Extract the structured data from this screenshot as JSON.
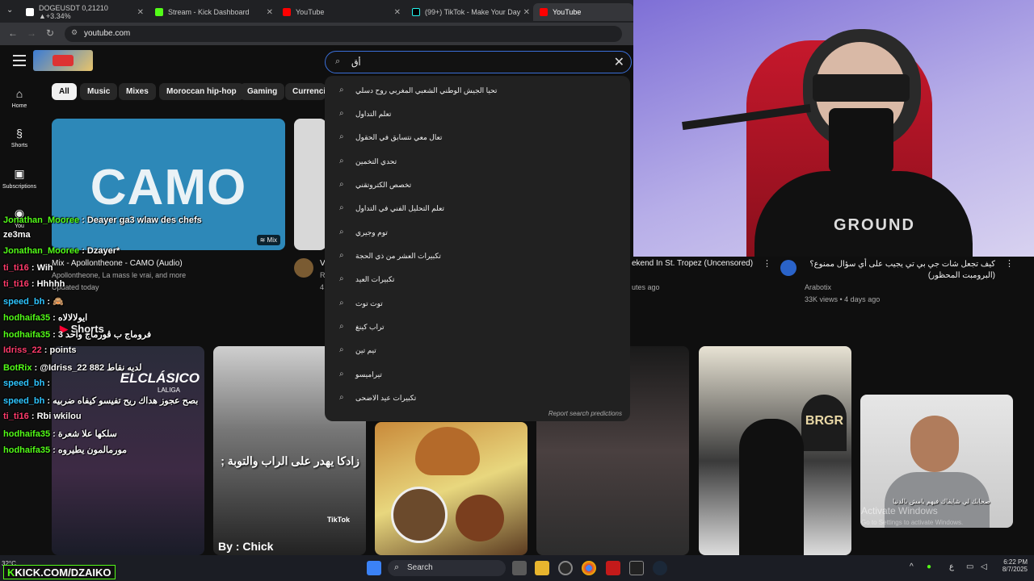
{
  "browser": {
    "tabs": [
      {
        "label": "DOGEUSDT 0,21210 ▲+3.34%",
        "active": false
      },
      {
        "label": "Stream - Kick Dashboard",
        "active": false
      },
      {
        "label": "YouTube",
        "active": false
      },
      {
        "label": "(99+) TikTok - Make Your Day",
        "active": false
      },
      {
        "label": "YouTube",
        "active": true
      }
    ],
    "url": "youtube.com"
  },
  "youtube": {
    "search_query": "أق",
    "sidebar": [
      {
        "label": "Home",
        "icon": "home-icon"
      },
      {
        "label": "Shorts",
        "icon": "shorts-icon"
      },
      {
        "label": "Subscriptions",
        "icon": "subscriptions-icon"
      },
      {
        "label": "You",
        "icon": "you-icon"
      }
    ],
    "chips": [
      "All",
      "Music",
      "Mixes",
      "Moroccan hip-hop",
      "Gaming",
      "Currencie"
    ],
    "suggestions": [
      "تحيا الجيش الوطني الشعبي المغربي روح دسلي",
      "تعلم التداول",
      "تعال معي نتسابق في الحقول",
      "تحدي التخمين",
      "تخصص الكتروتقني",
      "تعلم التحليل الفني في التداول",
      "توم وجيري",
      "تكبيرات العشر من ذي الحجة",
      "تكبيرات العيد",
      "توت توت",
      "تراب كينغ",
      "تيم تين",
      "تيراميسو",
      "تكبيرات عيد الاضحى"
    ],
    "report_label": "Report search predictions",
    "videos": [
      {
        "thumb_text": "CAMO",
        "badge": "Mix",
        "title": "Mix - Apollontheone - CAMO (Audio)",
        "meta1": "Apollontheone, La mass le vrai, and more",
        "meta2": "Updated today"
      },
      {
        "title": "V",
        "meta1": "R",
        "meta2": "4"
      },
      {
        "title": "ekend In St. Tropez (Uncensored)",
        "meta1": "",
        "meta2": "utes ago"
      },
      {
        "title": "كيف تجعل شات جي بي تي يجيب على أي سؤال ممنوع؟ (البرومبت المحظور)",
        "meta1": "Arabotix",
        "meta2": "33K views • 4 days ago"
      }
    ],
    "shorts_label": "Shorts",
    "shorts": [
      {
        "text": "ELCLÁSICO",
        "sub": "LALIGA"
      },
      {
        "text": "زادكا يهدر على الراب والتوبة ;",
        "tag": "TikTok",
        "footer": "By : Chick"
      },
      {
        "text": ""
      },
      {
        "text": ""
      },
      {
        "text": "BRGR"
      },
      {
        "text": "صحابك لي شايفاك فيهم يامش بالدنيا"
      }
    ]
  },
  "chat": [
    {
      "user": "Jonathan_Mooree",
      "msg": "Deayer ga3 wlaw des chefs",
      "color": "u"
    },
    {
      "user": "",
      "msg": "ze3ma",
      "color": "u"
    },
    {
      "user": "Jonathan_Mooree",
      "msg": "Dzayer*",
      "color": "u"
    },
    {
      "user": "ti_ti16",
      "msg": "Wih",
      "color": "u2"
    },
    {
      "user": "ti_ti16",
      "msg": "Hhhhh",
      "color": "u2"
    },
    {
      "user": "speed_bh",
      "msg": "🙈",
      "color": "u3"
    },
    {
      "user": "hodhaifa35",
      "msg": "ايولالالاه",
      "color": "u"
    },
    {
      "user": "hodhaifa35",
      "msg": "فروماج ب ڤورماج واحد 3",
      "color": "u"
    },
    {
      "user": "Idriss_22",
      "msg": "points",
      "color": "u2"
    },
    {
      "user": "BotRix",
      "msg": "@Idriss_22 882 لديه نقاط",
      "color": "u"
    },
    {
      "user": "speed_bh",
      "msg": "",
      "color": "u3"
    },
    {
      "user": "speed_bh",
      "msg": "بصح عجوز هداك ريح تفيسو كيفاه ضربيه",
      "color": "u3"
    },
    {
      "user": "ti_ti16",
      "msg": "Rbi wkilou",
      "color": "u2"
    },
    {
      "user": "hodhaifa35",
      "msg": "سلكها علا شعرة",
      "color": "u"
    },
    {
      "user": "hodhaifa35",
      "msg": "مورمالمون يطيروه",
      "color": "u"
    }
  ],
  "overlay": {
    "kick_handle": "KICK.COM/DZAIKO",
    "temperature": "32°C",
    "watermark": "Activate Windows",
    "watermark_sub": "Go to Settings to activate Windows."
  },
  "taskbar": {
    "search_label": "Search",
    "time": "6:22 PM",
    "date": "8/7/2025",
    "lang": "ع"
  },
  "colors": {
    "accent": "#3ea6ff",
    "kick_green": "#53fc18",
    "yt_red": "#ff0000"
  }
}
